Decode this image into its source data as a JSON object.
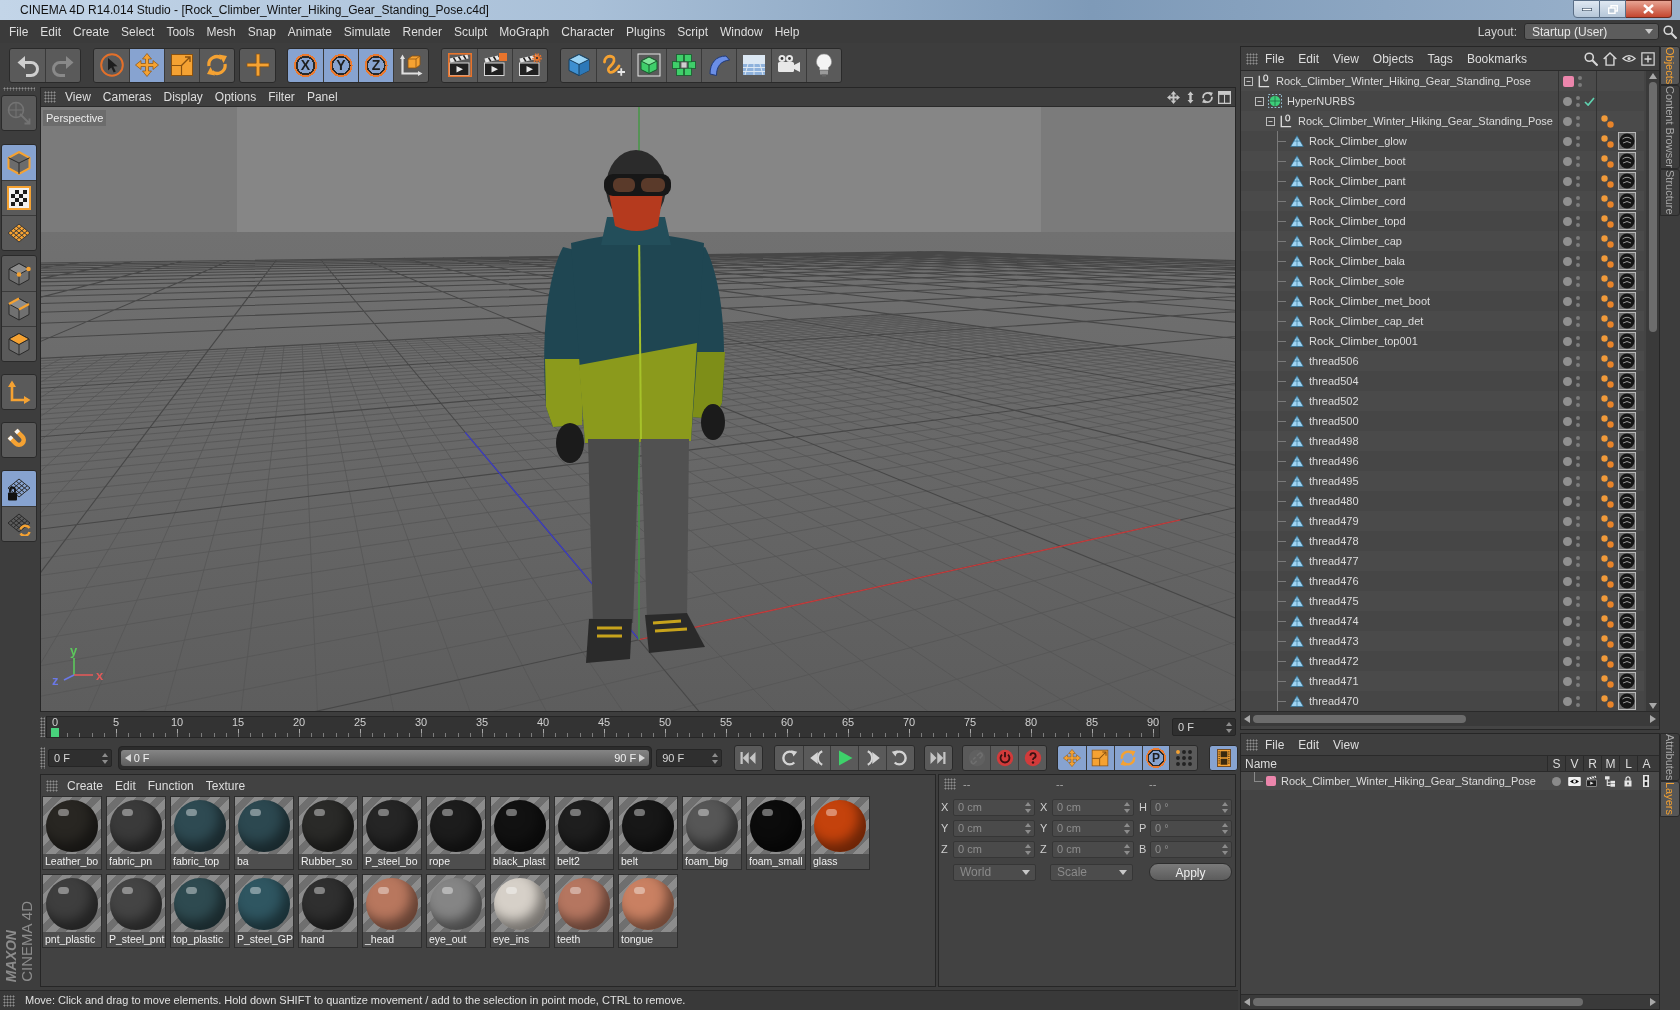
{
  "window": {
    "title": "CINEMA 4D R14.014 Studio - [Rock_Climber_Winter_Hiking_Gear_Standing_Pose.c4d]"
  },
  "menu_bar": [
    "File",
    "Edit",
    "Create",
    "Select",
    "Tools",
    "Mesh",
    "Snap",
    "Animate",
    "Simulate",
    "Render",
    "Sculpt",
    "MoGraph",
    "Character",
    "Plugins",
    "Script",
    "Window",
    "Help"
  ],
  "layout": {
    "label": "Layout:",
    "value": "Startup (User)"
  },
  "toolbar": [
    [
      {
        "kind": "undo",
        "active": false,
        "disabled": false
      },
      {
        "kind": "redo",
        "active": false,
        "disabled": true
      }
    ],
    [
      {
        "kind": "select",
        "active": false
      },
      {
        "kind": "move",
        "active": true
      },
      {
        "kind": "scale",
        "active": false
      },
      {
        "kind": "rotate",
        "active": false
      }
    ],
    [
      {
        "kind": "plus",
        "active": false
      }
    ],
    [
      {
        "kind": "axis",
        "label": "X",
        "active": true
      },
      {
        "kind": "axis",
        "label": "Y",
        "active": true
      },
      {
        "kind": "axis",
        "label": "Z",
        "active": true
      },
      {
        "kind": "world",
        "active": false
      }
    ],
    [
      {
        "kind": "render-view",
        "active": false
      },
      {
        "kind": "render-picture",
        "active": false
      },
      {
        "kind": "render-settings",
        "active": false
      }
    ],
    [
      {
        "kind": "cube",
        "active": false
      },
      {
        "kind": "spline",
        "active": false
      },
      {
        "kind": "subdivision",
        "active": false
      },
      {
        "kind": "cloner",
        "active": false
      },
      {
        "kind": "deformer",
        "active": false
      },
      {
        "kind": "floor",
        "active": false
      },
      {
        "kind": "camera",
        "active": false
      },
      {
        "kind": "light",
        "active": false
      }
    ]
  ],
  "mode_toolbar": [
    [
      {
        "kind": "make-editable",
        "active": false,
        "disabled": true
      }
    ],
    [
      {
        "kind": "model",
        "active": true
      },
      {
        "kind": "texture",
        "active": false
      },
      {
        "kind": "workplane",
        "active": false
      }
    ],
    [
      {
        "kind": "points",
        "active": false
      },
      {
        "kind": "edges",
        "active": false
      },
      {
        "kind": "polygons",
        "active": false
      }
    ],
    [
      {
        "kind": "axis-mode",
        "active": false
      }
    ],
    [
      {
        "kind": "snap",
        "active": false
      }
    ],
    [
      {
        "kind": "lock-workplane",
        "active": true
      },
      {
        "kind": "planar-workplane",
        "active": false
      }
    ]
  ],
  "logo": {
    "brand": "MAXON",
    "product": "CINEMA 4D"
  },
  "viewport": {
    "menu": [
      "View",
      "Cameras",
      "Display",
      "Options",
      "Filter",
      "Panel"
    ],
    "camera": "Perspective",
    "axis_labels": [
      {
        "text": "y",
        "color": "#5cc85c"
      },
      {
        "text": "z",
        "color": "#6a78e6"
      },
      {
        "text": "x",
        "color": "#e05a5a"
      }
    ]
  },
  "timeline": {
    "ticks": [
      "0",
      "5",
      "10",
      "15",
      "20",
      "25",
      "30",
      "35",
      "40",
      "45",
      "50",
      "55",
      "60",
      "65",
      "70",
      "75",
      "80",
      "85",
      "90"
    ],
    "level": 0,
    "frame": "0 F"
  },
  "playback": {
    "start": "0 F",
    "range_start": "0 F",
    "range_end": "90 F",
    "level": 1,
    "end": "90 F"
  },
  "animation_toolbar": [
    [
      {
        "kind": "first-frame",
        "active": false
      }
    ],
    [
      {
        "kind": "prev-key",
        "active": false
      },
      {
        "kind": "step-back",
        "active": false
      },
      {
        "kind": "play",
        "active": false
      },
      {
        "kind": "step-forward",
        "active": false
      },
      {
        "kind": "next-key",
        "active": false
      }
    ],
    [
      {
        "kind": "last-frame",
        "active": false
      }
    ],
    [
      {
        "kind": "link",
        "active": false,
        "disabled": true
      },
      {
        "kind": "record",
        "active": false,
        "disabled": false
      },
      {
        "kind": "autokey",
        "active": false,
        "disabled": false
      }
    ],
    [
      {
        "kind": "move",
        "active": true
      },
      {
        "kind": "scale",
        "active": true
      },
      {
        "kind": "rotate",
        "active": true
      },
      {
        "kind": "param",
        "label": "P",
        "active": true
      },
      {
        "kind": "dots",
        "active": false
      }
    ],
    [
      {
        "kind": "film",
        "active": true
      }
    ]
  ],
  "materials": {
    "menu": [
      "Create",
      "Edit",
      "Function",
      "Texture"
    ],
    "items": [
      {
        "name": "Leather_bo",
        "color": "#282622"
      },
      {
        "name": "fabric_pn",
        "color": "#3a3a3a"
      },
      {
        "name": "fabric_top",
        "color": "#2e4a52"
      },
      {
        "name": "ba",
        "color": "#2c4850"
      },
      {
        "name": "Rubber_so",
        "color": "#2a2a28"
      },
      {
        "name": "P_steel_bo",
        "color": "#252525"
      },
      {
        "name": "rope",
        "color": "#1c1c1c"
      },
      {
        "name": "black_plast",
        "color": "#111111"
      },
      {
        "name": "belt2",
        "color": "#1e1e1e"
      },
      {
        "name": "belt",
        "color": "#171717"
      },
      {
        "name": "foam_big",
        "color": "#565656"
      },
      {
        "name": "foam_small",
        "color": "#0b0b0b"
      },
      {
        "name": "glass",
        "color": "#c4420c"
      },
      {
        "name": "pnt_plastic",
        "color": "#3e3e3e"
      },
      {
        "name": "P_steel_pnt",
        "color": "#444444"
      },
      {
        "name": "top_plastic",
        "color": "#2e4a50"
      },
      {
        "name": "P_steel_GP",
        "color": "#2f5661"
      },
      {
        "name": "hand",
        "color": "#2f2f2f"
      },
      {
        "name": "_head",
        "color": "#b8775e"
      },
      {
        "name": "eye_out",
        "color": "#858585"
      },
      {
        "name": "eye_ins",
        "color": "#d6d0c8"
      },
      {
        "name": "teeth",
        "color": "#b57660"
      },
      {
        "name": "tongue",
        "color": "#c98062"
      }
    ]
  },
  "coordinates": {
    "headers": [
      "--",
      "--",
      "--"
    ],
    "rows": [
      {
        "position": {
          "axis": "X",
          "value": "0 cm"
        },
        "size": {
          "axis": "X",
          "value": "0 cm"
        },
        "rotation": {
          "axis": "H",
          "value": "0 °"
        }
      },
      {
        "position": {
          "axis": "Y",
          "value": "0 cm"
        },
        "size": {
          "axis": "Y",
          "value": "0 cm"
        },
        "rotation": {
          "axis": "P",
          "value": "0 °"
        }
      },
      {
        "position": {
          "axis": "Z",
          "value": "0 cm"
        },
        "size": {
          "axis": "Z",
          "value": "0 cm"
        },
        "rotation": {
          "axis": "B",
          "value": "0 °"
        }
      }
    ],
    "space": "World",
    "mode": "Scale",
    "apply": "Apply"
  },
  "object_manager": {
    "menu": [
      "File",
      "Edit",
      "View",
      "Objects",
      "Tags",
      "Bookmarks"
    ],
    "tree": [
      {
        "name": "Rock_Climber_Winter_Hiking_Gear_Standing_Pose",
        "kind": "null",
        "expanded": true,
        "color": "#ec86ac",
        "children": [
          {
            "name": "HyperNURBS",
            "kind": "hypernurbs",
            "expanded": true,
            "enabled": true,
            "children": [
              {
                "name": "Rock_Climber_Winter_Hiking_Gear_Standing_Pose",
                "kind": "null",
                "expanded": true,
                "tags": [
                  {
                    "kind": "phong"
                  }
                ],
                "children": [
                  {
                    "name": "Rock_Climber_glow",
                    "kind": "polygon",
                    "tags": [
                      {
                        "kind": "phong"
                      },
                      {
                        "kind": "material"
                      }
                    ]
                  },
                  {
                    "name": "Rock_Climber_boot",
                    "kind": "polygon",
                    "tags": [
                      {
                        "kind": "phong"
                      },
                      {
                        "kind": "material"
                      }
                    ]
                  },
                  {
                    "name": "Rock_Climber_pant",
                    "kind": "polygon",
                    "tags": [
                      {
                        "kind": "phong"
                      },
                      {
                        "kind": "material"
                      }
                    ]
                  },
                  {
                    "name": "Rock_Climber_cord",
                    "kind": "polygon",
                    "tags": [
                      {
                        "kind": "phong"
                      },
                      {
                        "kind": "material"
                      }
                    ]
                  },
                  {
                    "name": "Rock_Climber_topd",
                    "kind": "polygon",
                    "tags": [
                      {
                        "kind": "phong"
                      },
                      {
                        "kind": "material"
                      }
                    ]
                  },
                  {
                    "name": "Rock_Climber_cap",
                    "kind": "polygon",
                    "tags": [
                      {
                        "kind": "phong"
                      },
                      {
                        "kind": "material"
                      }
                    ]
                  },
                  {
                    "name": "Rock_Climber_bala",
                    "kind": "polygon",
                    "tags": [
                      {
                        "kind": "phong"
                      },
                      {
                        "kind": "material"
                      }
                    ]
                  },
                  {
                    "name": "Rock_Climber_sole",
                    "kind": "polygon",
                    "tags": [
                      {
                        "kind": "phong"
                      },
                      {
                        "kind": "material"
                      }
                    ]
                  },
                  {
                    "name": "Rock_Climber_met_boot",
                    "kind": "polygon",
                    "tags": [
                      {
                        "kind": "phong"
                      },
                      {
                        "kind": "material"
                      }
                    ]
                  },
                  {
                    "name": "Rock_Climber_cap_det",
                    "kind": "polygon",
                    "tags": [
                      {
                        "kind": "phong"
                      },
                      {
                        "kind": "material"
                      }
                    ]
                  },
                  {
                    "name": "Rock_Climber_top001",
                    "kind": "polygon",
                    "tags": [
                      {
                        "kind": "phong"
                      },
                      {
                        "kind": "material"
                      }
                    ]
                  },
                  {
                    "name": "thread506",
                    "kind": "polygon",
                    "tags": [
                      {
                        "kind": "phong"
                      },
                      {
                        "kind": "material"
                      }
                    ]
                  },
                  {
                    "name": "thread504",
                    "kind": "polygon",
                    "tags": [
                      {
                        "kind": "phong"
                      },
                      {
                        "kind": "material"
                      }
                    ]
                  },
                  {
                    "name": "thread502",
                    "kind": "polygon",
                    "tags": [
                      {
                        "kind": "phong"
                      },
                      {
                        "kind": "material"
                      }
                    ]
                  },
                  {
                    "name": "thread500",
                    "kind": "polygon",
                    "tags": [
                      {
                        "kind": "phong"
                      },
                      {
                        "kind": "material"
                      }
                    ]
                  },
                  {
                    "name": "thread498",
                    "kind": "polygon",
                    "tags": [
                      {
                        "kind": "phong"
                      },
                      {
                        "kind": "material"
                      }
                    ]
                  },
                  {
                    "name": "thread496",
                    "kind": "polygon",
                    "tags": [
                      {
                        "kind": "phong"
                      },
                      {
                        "kind": "material"
                      }
                    ]
                  },
                  {
                    "name": "thread495",
                    "kind": "polygon",
                    "tags": [
                      {
                        "kind": "phong"
                      },
                      {
                        "kind": "material"
                      }
                    ]
                  },
                  {
                    "name": "thread480",
                    "kind": "polygon",
                    "tags": [
                      {
                        "kind": "phong"
                      },
                      {
                        "kind": "material"
                      }
                    ]
                  },
                  {
                    "name": "thread479",
                    "kind": "polygon",
                    "tags": [
                      {
                        "kind": "phong"
                      },
                      {
                        "kind": "material"
                      }
                    ]
                  },
                  {
                    "name": "thread478",
                    "kind": "polygon",
                    "tags": [
                      {
                        "kind": "phong"
                      },
                      {
                        "kind": "material"
                      }
                    ]
                  },
                  {
                    "name": "thread477",
                    "kind": "polygon",
                    "tags": [
                      {
                        "kind": "phong"
                      },
                      {
                        "kind": "material"
                      }
                    ]
                  },
                  {
                    "name": "thread476",
                    "kind": "polygon",
                    "tags": [
                      {
                        "kind": "phong"
                      },
                      {
                        "kind": "material"
                      }
                    ]
                  },
                  {
                    "name": "thread475",
                    "kind": "polygon",
                    "tags": [
                      {
                        "kind": "phong"
                      },
                      {
                        "kind": "material"
                      }
                    ]
                  },
                  {
                    "name": "thread474",
                    "kind": "polygon",
                    "tags": [
                      {
                        "kind": "phong"
                      },
                      {
                        "kind": "material"
                      }
                    ]
                  },
                  {
                    "name": "thread473",
                    "kind": "polygon",
                    "tags": [
                      {
                        "kind": "phong"
                      },
                      {
                        "kind": "material"
                      }
                    ]
                  },
                  {
                    "name": "thread472",
                    "kind": "polygon",
                    "tags": [
                      {
                        "kind": "phong"
                      },
                      {
                        "kind": "material"
                      }
                    ]
                  },
                  {
                    "name": "thread471",
                    "kind": "polygon",
                    "tags": [
                      {
                        "kind": "phong"
                      },
                      {
                        "kind": "material"
                      }
                    ]
                  },
                  {
                    "name": "thread470",
                    "kind": "polygon",
                    "tags": [
                      {
                        "kind": "phong"
                      },
                      {
                        "kind": "material"
                      }
                    ]
                  }
                ]
              }
            ]
          }
        ]
      }
    ]
  },
  "side_tabs_top": [
    {
      "label": "Objects",
      "selected": true
    },
    {
      "label": "Content Browser",
      "selected": false
    },
    {
      "label": "Structure",
      "selected": false
    }
  ],
  "layer_manager": {
    "menu": [
      "File",
      "Edit",
      "View"
    ],
    "columns": [
      "Name",
      "S",
      "V",
      "R",
      "M",
      "L",
      "A"
    ],
    "rows": [
      {
        "name": "Rock_Climber_Winter_Hiking_Gear_Standing_Pose",
        "color": "#ec86ac"
      }
    ]
  },
  "side_tabs_bottom": [
    {
      "label": "Attributes",
      "selected": false
    },
    {
      "label": "Layers",
      "selected": true
    }
  ],
  "status_bar": {
    "text": "Move: Click and drag to move elements. Hold down SHIFT to quantize movement / add to the selection in point mode, CTRL to remove."
  }
}
